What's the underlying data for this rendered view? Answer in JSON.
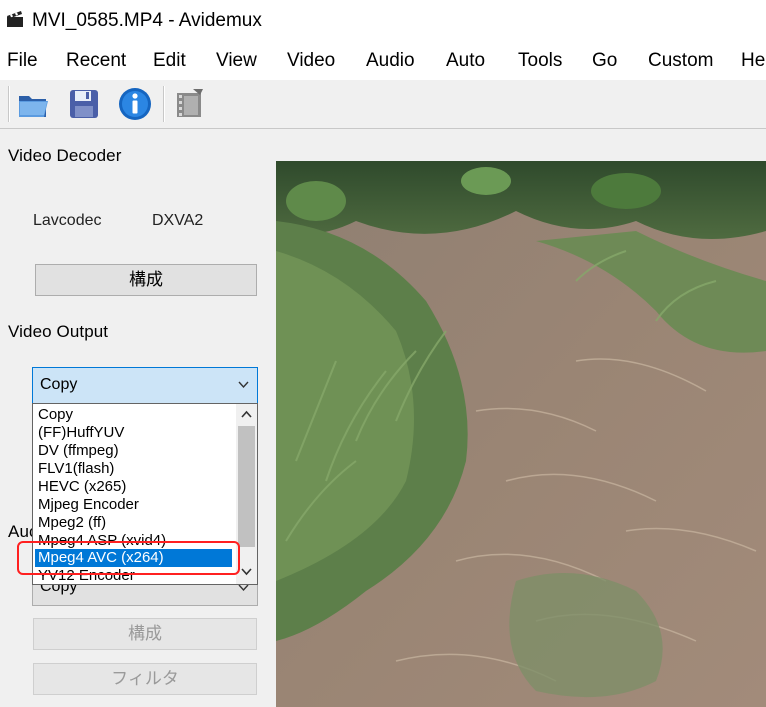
{
  "window": {
    "title": "MVI_0585.MP4 - Avidemux"
  },
  "menu": {
    "items": [
      "File",
      "Recent",
      "Edit",
      "View",
      "Video",
      "Audio",
      "Auto",
      "Tools",
      "Go",
      "Custom",
      "He"
    ]
  },
  "toolbar": {
    "buttons": [
      "open-folder-icon",
      "save-disk-icon",
      "info-icon",
      "film-filter-icon"
    ]
  },
  "video_decoder": {
    "title": "Video Decoder",
    "decoder": "Lavcodec",
    "hwaccel": "DXVA2",
    "configure_label": "構成"
  },
  "video_output": {
    "title": "Video Output",
    "selected": "Copy",
    "options": [
      "Copy",
      "(FF)HuffYUV",
      "DV (ffmpeg)",
      "FLV1(flash)",
      "HEVC (x265)",
      "Mjpeg Encoder",
      "Mpeg2 (ff)",
      "Mpeg4 ASP (xvid4)",
      "Mpeg4 AVC (x264)",
      "YV12 Encoder"
    ],
    "highlighted_option": "Mpeg4 AVC (x264)"
  },
  "audio_output": {
    "title_partial": "Auc",
    "selected": "Copy",
    "configure_label": "構成",
    "filter_label": "フィルタ"
  },
  "colors": {
    "selection": "#0078d7",
    "highlight_outline": "#ff2020",
    "combo_bg": "#cce4f7",
    "combo_border": "#0078d7"
  }
}
